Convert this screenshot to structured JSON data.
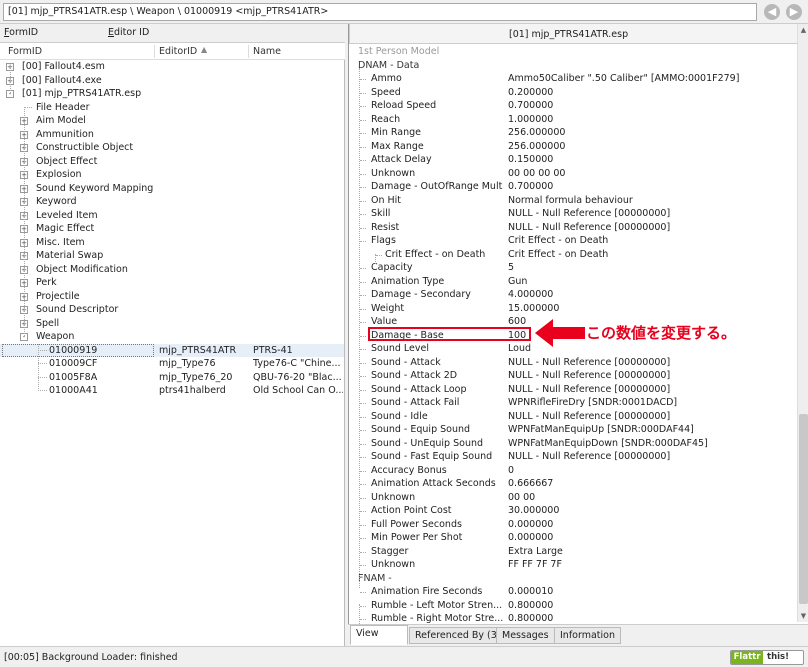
{
  "address": "[01] mjp_PTRS41ATR.esp \\ Weapon \\ 01000919 <mjp_PTRS41ATR>",
  "nav": {
    "back": "◀",
    "forward": "▶"
  },
  "search_tabs": {
    "formid_u": "F",
    "formid_rest": "ormID",
    "editorid_u": "E",
    "editorid_rest": "ditor ID"
  },
  "columns": {
    "formid": "FormID",
    "editorid": "EditorID",
    "name": "Name"
  },
  "tree": [
    {
      "label": "[00] Fallout4.esm",
      "level": 0,
      "expander": "+"
    },
    {
      "label": "[00] Fallout4.exe",
      "level": 0,
      "expander": "+"
    },
    {
      "label": "[01] mjp_PTRS41ATR.esp",
      "level": 0,
      "expander": "-"
    },
    {
      "label": "File Header",
      "level": 1,
      "expander": ""
    },
    {
      "label": "Aim Model",
      "level": 1,
      "expander": "+"
    },
    {
      "label": "Ammunition",
      "level": 1,
      "expander": "+"
    },
    {
      "label": "Constructible Object",
      "level": 1,
      "expander": "+"
    },
    {
      "label": "Object Effect",
      "level": 1,
      "expander": "+"
    },
    {
      "label": "Explosion",
      "level": 1,
      "expander": "+"
    },
    {
      "label": "Sound Keyword Mapping",
      "level": 1,
      "expander": "+"
    },
    {
      "label": "Keyword",
      "level": 1,
      "expander": "+"
    },
    {
      "label": "Leveled Item",
      "level": 1,
      "expander": "+"
    },
    {
      "label": "Magic Effect",
      "level": 1,
      "expander": "+"
    },
    {
      "label": "Misc. Item",
      "level": 1,
      "expander": "+"
    },
    {
      "label": "Material Swap",
      "level": 1,
      "expander": "+"
    },
    {
      "label": "Object Modification",
      "level": 1,
      "expander": "+"
    },
    {
      "label": "Perk",
      "level": 1,
      "expander": "+"
    },
    {
      "label": "Projectile",
      "level": 1,
      "expander": "+"
    },
    {
      "label": "Sound Descriptor",
      "level": 1,
      "expander": "+"
    },
    {
      "label": "Spell",
      "level": 1,
      "expander": "+"
    },
    {
      "label": "Weapon",
      "level": 1,
      "expander": "-"
    }
  ],
  "weapons": [
    {
      "formid": "01000919",
      "editorid": "mjp_PTRS41ATR",
      "name": "PTRS-41",
      "selected": true
    },
    {
      "formid": "010009CF",
      "editorid": "mjp_Type76",
      "name": "Type76-C \"Chine...",
      "selected": false
    },
    {
      "formid": "01005F8A",
      "editorid": "mjp_Type76_20",
      "name": "QBU-76-20 \"Blac...",
      "selected": false
    },
    {
      "formid": "01000A41",
      "editorid": "ptrs41halberd",
      "name": "Old School Can O...",
      "selected": false
    }
  ],
  "record_header": "[01] mjp_PTRS41ATR.esp",
  "rows": [
    {
      "name": "1st Person Model",
      "value": "",
      "indent": 0,
      "style": "grey"
    },
    {
      "name": "DNAM - Data",
      "value": "",
      "indent": 0,
      "style": "section"
    },
    {
      "name": "Ammo",
      "value": "Ammo50Caliber \".50 Caliber\" [AMMO:0001F279]",
      "indent": 1
    },
    {
      "name": "Speed",
      "value": "0.200000",
      "indent": 1
    },
    {
      "name": "Reload Speed",
      "value": "0.700000",
      "indent": 1
    },
    {
      "name": "Reach",
      "value": "1.000000",
      "indent": 1
    },
    {
      "name": "Min Range",
      "value": "256.000000",
      "indent": 1
    },
    {
      "name": "Max Range",
      "value": "256.000000",
      "indent": 1
    },
    {
      "name": "Attack Delay",
      "value": "0.150000",
      "indent": 1
    },
    {
      "name": "Unknown",
      "value": "00 00 00 00",
      "indent": 1
    },
    {
      "name": "Damage - OutOfRange Mult",
      "value": "0.700000",
      "indent": 1
    },
    {
      "name": "On Hit",
      "value": "Normal formula behaviour",
      "indent": 1
    },
    {
      "name": "Skill",
      "value": "NULL - Null Reference [00000000]",
      "indent": 1
    },
    {
      "name": "Resist",
      "value": "NULL - Null Reference [00000000]",
      "indent": 1
    },
    {
      "name": "Flags",
      "value": "Crit Effect - on Death",
      "indent": 1
    },
    {
      "name": "Crit Effect - on Death",
      "value": "Crit Effect - on Death",
      "indent": 2
    },
    {
      "name": "Capacity",
      "value": "5",
      "indent": 1
    },
    {
      "name": "Animation Type",
      "value": "Gun",
      "indent": 1
    },
    {
      "name": "Damage - Secondary",
      "value": "4.000000",
      "indent": 1
    },
    {
      "name": "Weight",
      "value": "15.000000",
      "indent": 1
    },
    {
      "name": "Value",
      "value": "600",
      "indent": 1
    },
    {
      "name": "Damage - Base",
      "value": "100",
      "indent": 1
    },
    {
      "name": "Sound Level",
      "value": "Loud",
      "indent": 1
    },
    {
      "name": "Sound - Attack",
      "value": "NULL - Null Reference [00000000]",
      "indent": 1
    },
    {
      "name": "Sound - Attack 2D",
      "value": "NULL - Null Reference [00000000]",
      "indent": 1
    },
    {
      "name": "Sound - Attack Loop",
      "value": "NULL - Null Reference [00000000]",
      "indent": 1
    },
    {
      "name": "Sound - Attack Fail",
      "value": "WPNRifleFireDry [SNDR:0001DACD]",
      "indent": 1
    },
    {
      "name": "Sound - Idle",
      "value": "NULL - Null Reference [00000000]",
      "indent": 1
    },
    {
      "name": "Sound - Equip Sound",
      "value": "WPNFatManEquipUp [SNDR:000DAF44]",
      "indent": 1
    },
    {
      "name": "Sound - UnEquip Sound",
      "value": "WPNFatManEquipDown [SNDR:000DAF45]",
      "indent": 1
    },
    {
      "name": "Sound - Fast Equip Sound",
      "value": "NULL - Null Reference [00000000]",
      "indent": 1
    },
    {
      "name": "Accuracy Bonus",
      "value": "0",
      "indent": 1
    },
    {
      "name": "Animation Attack Seconds",
      "value": "0.666667",
      "indent": 1
    },
    {
      "name": "Unknown",
      "value": "00 00",
      "indent": 1
    },
    {
      "name": "Action Point Cost",
      "value": "30.000000",
      "indent": 1
    },
    {
      "name": "Full Power Seconds",
      "value": "0.000000",
      "indent": 1
    },
    {
      "name": "Min Power Per Shot",
      "value": "0.000000",
      "indent": 1
    },
    {
      "name": "Stagger",
      "value": "Extra Large",
      "indent": 1
    },
    {
      "name": "Unknown",
      "value": "FF FF 7F 7F",
      "indent": 1
    },
    {
      "name": "FNAM -",
      "value": "",
      "indent": 0,
      "style": "section"
    },
    {
      "name": "Animation Fire Seconds",
      "value": "0.000010",
      "indent": 1
    },
    {
      "name": "Rumble - Left Motor Stren...",
      "value": "0.800000",
      "indent": 1
    },
    {
      "name": "Rumble - Right Motor Stre...",
      "value": "0.800000",
      "indent": 1
    }
  ],
  "annotation": "この数値を変更する。",
  "bottom_tabs": [
    "View",
    "Referenced By (3)",
    "Messages",
    "Information"
  ],
  "status": "[00:05] Background Loader: finished",
  "flattr": {
    "left": "Flattr",
    "right": "this!"
  },
  "colors": {
    "accent": "#e8001c",
    "flattr": "#7ab51d"
  }
}
